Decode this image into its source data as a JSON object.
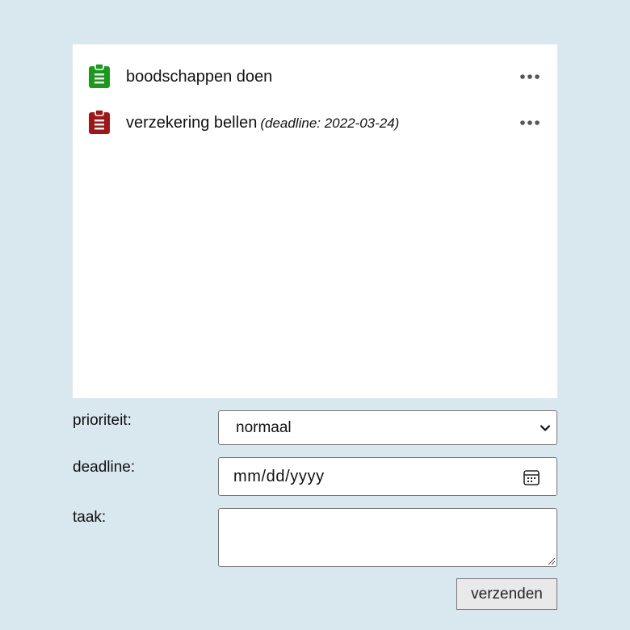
{
  "tasks": [
    {
      "title": "boodschappen doen",
      "deadline_text": "",
      "icon": "clipboard-icon",
      "icon_color": "#1a9a1a",
      "menu_icon": "more-horizontal-icon"
    },
    {
      "title": "verzekering bellen",
      "deadline_text": "(deadline: 2022-03-24)",
      "icon": "clipboard-icon",
      "icon_color": "#a01515",
      "menu_icon": "more-horizontal-icon"
    }
  ],
  "form": {
    "priority_label": "prioriteit:",
    "priority_value": "normaal",
    "deadline_label": "deadline:",
    "deadline_placeholder": "mm/dd/yyyy",
    "task_label": "taak:",
    "task_value": "",
    "submit_label": "verzenden"
  },
  "colors": {
    "background": "#d9e7ef",
    "panel": "#ffffff",
    "button": "#e9e9e9"
  }
}
